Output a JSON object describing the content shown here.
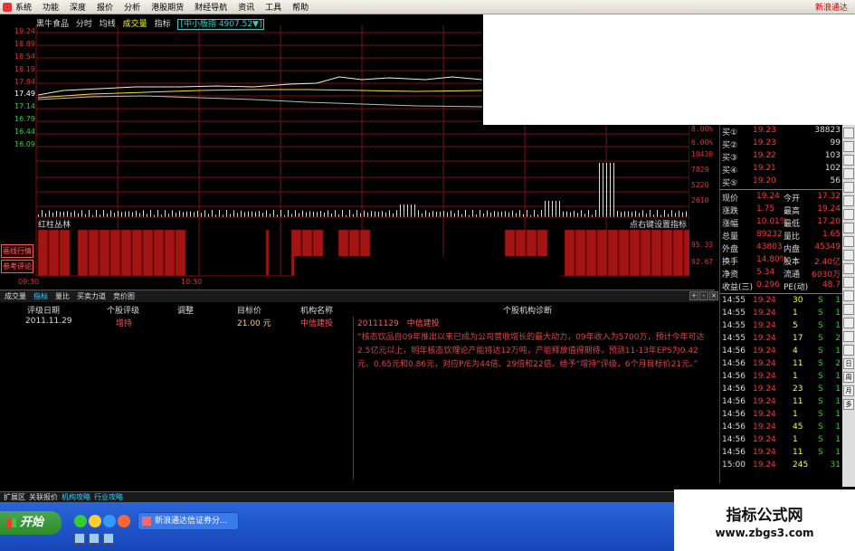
{
  "menu": {
    "items": [
      "系统",
      "功能",
      "深度",
      "报价",
      "分析",
      "港股期货",
      "财经导航",
      "资讯",
      "工具",
      "帮助"
    ],
    "brand": "新浪通达"
  },
  "chart_toolbar": {
    "stock_name": "黑牛食品",
    "modes": [
      "分时",
      "均线",
      "成交量",
      "指标"
    ],
    "index_label": "[中小板指 4907.52▼]"
  },
  "price_axis": [
    "19.24",
    "18.89",
    "18.54",
    "18.19",
    "17.84",
    "17.49",
    "17.14",
    "16.79",
    "16.44",
    "16.09"
  ],
  "right_axis_upper": [
    "8.00%",
    "6.00%"
  ],
  "right_axis_volume": [
    "10439",
    "7829",
    "5220",
    "2610"
  ],
  "time_labels": [
    "09:30",
    "10:30"
  ],
  "indicator": {
    "name": "红柱丛林",
    "hint": "点右键设置指标",
    "values": [
      "95.33",
      "92.67"
    ]
  },
  "side_buttons": [
    "画线行情",
    "参考评论"
  ],
  "tabs": [
    "成交量",
    "指标",
    "量比",
    "买卖力道",
    "竞价图"
  ],
  "tab_controls": [
    "+",
    "-",
    "×"
  ],
  "rating_table": {
    "headers": [
      "评级日期",
      "个股评级",
      "调整",
      "目标价",
      "机构名称"
    ],
    "rows": [
      {
        "date": "2011.11.29",
        "rating": "增持",
        "adjust": "",
        "target": "21.00 元",
        "institution": "中信建投"
      }
    ]
  },
  "diagnosis": {
    "header": "个股机构诊断",
    "date": "20111129",
    "institution": "中信建投",
    "text": "“核态饮品自09年推出以来已成为公司营收增长的最大动力，09年收入为5700万，预计今年可达2.5亿元以上，明年核态饮理论产能将达12万吨，产能释放值得期待，预测11-13年EPS为0.42元、0.65元和0.86元，对应P/E为44倍、29倍和22倍。给予“增持”评级，6个月目标价21元。”"
  },
  "order_book": [
    {
      "label": "买①",
      "price": "19.23",
      "vol": "38823"
    },
    {
      "label": "买②",
      "price": "19.23",
      "vol": "99"
    },
    {
      "label": "买③",
      "price": "19.22",
      "vol": "103"
    },
    {
      "label": "买④",
      "price": "19.21",
      "vol": "102"
    },
    {
      "label": "买⑤",
      "price": "19.20",
      "vol": "56"
    }
  ],
  "stats": [
    {
      "l1": "现价",
      "v1": "19.24",
      "l2": "今开",
      "v2": "17.32"
    },
    {
      "l1": "涨跌",
      "v1": "1.75",
      "l2": "最高",
      "v2": "19.24"
    },
    {
      "l1": "涨幅",
      "v1": "10.01%",
      "l2": "最低",
      "v2": "17.20"
    },
    {
      "l1": "总量",
      "v1": "89232",
      "l2": "量比",
      "v2": "1.65"
    },
    {
      "l1": "外盘",
      "v1": "43803",
      "l2": "内盘",
      "v2": "45349"
    },
    {
      "l1": "换手",
      "v1": "14.80%",
      "l2": "股本",
      "v2": "2.40亿"
    },
    {
      "l1": "净资",
      "v1": "5.34",
      "l2": "流通",
      "v2": "6030万"
    },
    {
      "l1": "收益(三)",
      "v1": "0.296",
      "l2": "PE(动)",
      "v2": "48.7"
    }
  ],
  "ticks": [
    {
      "t": "14:55",
      "p": "19.24",
      "v": "30",
      "s": "S",
      "n": "1"
    },
    {
      "t": "14:55",
      "p": "19.24",
      "v": "1",
      "s": "S",
      "n": "1"
    },
    {
      "t": "14:55",
      "p": "19.24",
      "v": "5",
      "s": "S",
      "n": "1"
    },
    {
      "t": "14:55",
      "p": "19.24",
      "v": "17",
      "s": "S",
      "n": "2"
    },
    {
      "t": "14:56",
      "p": "19.24",
      "v": "4",
      "s": "S",
      "n": "1"
    },
    {
      "t": "14:56",
      "p": "19.24",
      "v": "11",
      "s": "S",
      "n": "2"
    },
    {
      "t": "14:56",
      "p": "19.24",
      "v": "1",
      "s": "S",
      "n": "1"
    },
    {
      "t": "14:56",
      "p": "19.24",
      "v": "23",
      "s": "S",
      "n": "1"
    },
    {
      "t": "14:56",
      "p": "19.24",
      "v": "11",
      "s": "S",
      "n": "1"
    },
    {
      "t": "14:56",
      "p": "19.24",
      "v": "1",
      "s": "S",
      "n": "1"
    },
    {
      "t": "14:56",
      "p": "19.24",
      "v": "45",
      "s": "S",
      "n": "1"
    },
    {
      "t": "14:56",
      "p": "19.24",
      "v": "1",
      "s": "S",
      "n": "1"
    },
    {
      "t": "14:56",
      "p": "19.24",
      "v": "11",
      "s": "S",
      "n": "1"
    },
    {
      "t": "15:00",
      "p": "19.24",
      "v": "245",
      "s": "",
      "n": "31"
    }
  ],
  "right_icons": [
    "日",
    "周",
    "月",
    "多"
  ],
  "bottom_tabs": [
    "扩展区",
    "关联报价",
    "机构攻略",
    "行业攻略"
  ],
  "taskbar": {
    "start": "开始",
    "task": "新浪通达信证券分..."
  },
  "watermark": {
    "title": "指标公式网",
    "url": "www.zbgs3.com"
  },
  "colors": {
    "up": "#ff3333",
    "grid": "#7a1010",
    "accent": "#33ccff",
    "bar": "#a31515"
  }
}
